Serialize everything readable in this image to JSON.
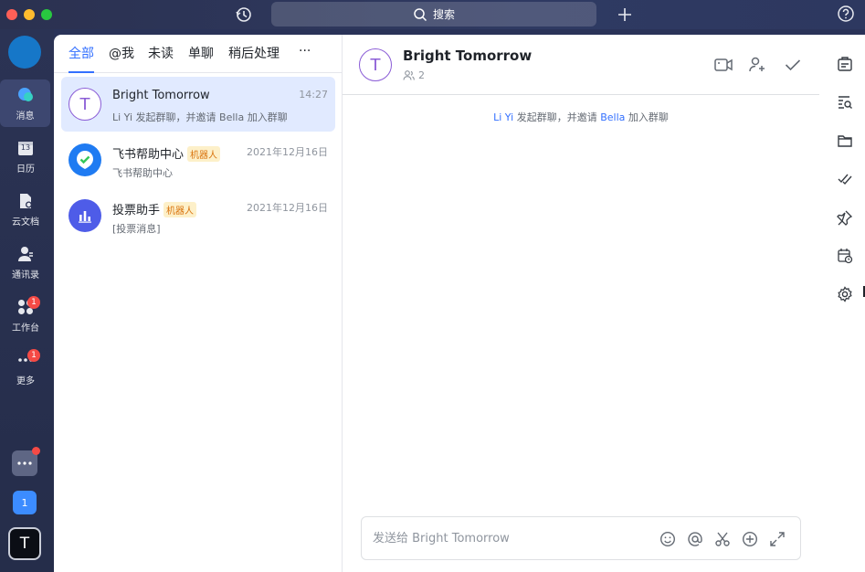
{
  "titlebar": {
    "search_label": "搜索"
  },
  "rail": {
    "items": [
      {
        "label": "消息",
        "icon": "chat-bubble-icon"
      },
      {
        "label": "日历",
        "icon": "calendar-icon",
        "calendar_day": "13"
      },
      {
        "label": "云文档",
        "icon": "doc-icon"
      },
      {
        "label": "通讯录",
        "icon": "contacts-icon"
      },
      {
        "label": "工作台",
        "icon": "workplace-icon",
        "badge": "1"
      },
      {
        "label": "更多",
        "icon": "more-icon",
        "badge": "1"
      }
    ],
    "workspace_badge": "1",
    "account_initial": "T"
  },
  "list": {
    "tabs": [
      "全部",
      "@我",
      "未读",
      "单聊",
      "稍后处理",
      "···"
    ],
    "conversations": [
      {
        "name": "Bright Tomorrow",
        "initial": "T",
        "time": "14:27",
        "preview": "Li Yi 发起群聊，并邀请 Bella 加入群聊"
      },
      {
        "name": "飞书帮助中心",
        "tag": "机器人",
        "time": "2021年12月16日",
        "preview": "飞书帮助中心"
      },
      {
        "name": "投票助手",
        "tag": "机器人",
        "time": "2021年12月16日",
        "preview": "[投票消息]"
      }
    ]
  },
  "chat": {
    "title": "Bright Tomorrow",
    "initial": "T",
    "member_count": "2",
    "system_message": {
      "user1": "Li Yi",
      "middle": " 发起群聊，并邀请 ",
      "user2": "Bella",
      "end": " 加入群聊"
    },
    "composer_placeholder": "发送给 Bright Tomorrow"
  },
  "colors": {
    "accent": "#3370ff",
    "rail_bg": "#2b3354",
    "badge": "#f54a45",
    "avatar_purple": "#8a5cd6"
  }
}
